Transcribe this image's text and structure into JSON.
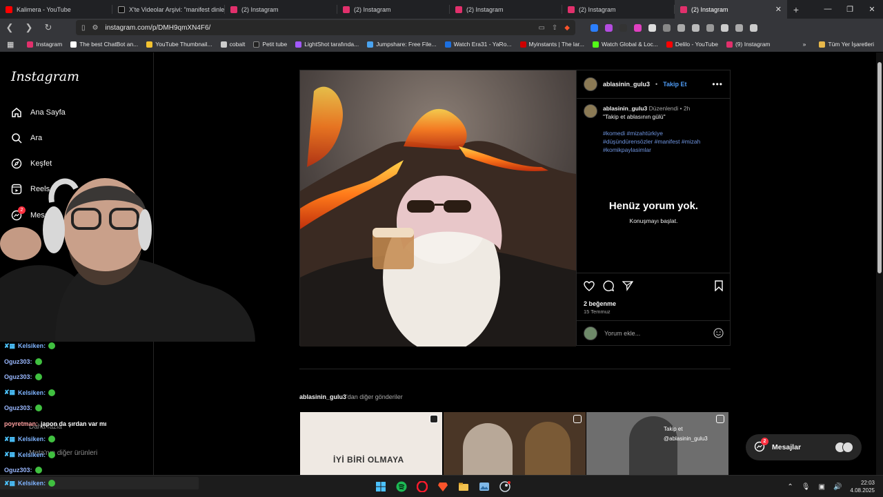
{
  "tabs": [
    {
      "label": "Kalimera - YouTube",
      "color": "#ff0000",
      "active": false
    },
    {
      "label": "X'te Videolar Arşivi: \"manifest dinley",
      "color": "#ffffff",
      "active": false
    },
    {
      "label": "(2) Instagram",
      "color": "#e1306c",
      "active": false
    },
    {
      "label": "(2) Instagram",
      "color": "#e1306c",
      "active": false
    },
    {
      "label": "(2) Instagram",
      "color": "#e1306c",
      "active": false
    },
    {
      "label": "(2) Instagram",
      "color": "#e1306c",
      "active": false
    },
    {
      "label": "(2) Instagram",
      "color": "#e1306c",
      "active": true
    }
  ],
  "address": {
    "url": "instagram.com/p/DMH9qmXN4F6/"
  },
  "bookmarks": [
    {
      "label": "Instagram",
      "color": "#e1306c"
    },
    {
      "label": "The best ChatBot an...",
      "color": "#ffffff"
    },
    {
      "label": "YouTube Thumbnail...",
      "color": "#f2c230"
    },
    {
      "label": "cobalt",
      "color": "#cccccc"
    },
    {
      "label": "Petit tube",
      "color": "#222222"
    },
    {
      "label": "LightShot tarafında...",
      "color": "#a259ff"
    },
    {
      "label": "Jumpshare: Free File...",
      "color": "#4aa3f0"
    },
    {
      "label": "Watch Era31 - YaRo...",
      "color": "#1c6fe0"
    },
    {
      "label": "Myinstants | The lar...",
      "color": "#cc0000"
    },
    {
      "label": "Watch Global & Loc...",
      "color": "#53fc18"
    },
    {
      "label": "Delilo - YouTube",
      "color": "#ff0000"
    },
    {
      "label": "(9) Instagram",
      "color": "#e1306c"
    }
  ],
  "bookmarks_folder": "Tüm Yer İşaretleri",
  "sidebar": {
    "logo": "Instagram",
    "items": [
      {
        "label": "Ana Sayfa",
        "icon": "home-icon"
      },
      {
        "label": "Ara",
        "icon": "search-icon"
      },
      {
        "label": "Keşfet",
        "icon": "compass-icon"
      },
      {
        "label": "Reels",
        "icon": "reels-icon"
      },
      {
        "label": "Mesajlar",
        "icon": "messenger-icon",
        "badge": "2"
      }
    ],
    "more_label": "Daha fazla",
    "meta_label": "Meta'nın diğer ürünleri"
  },
  "post": {
    "username": "ablasinin_gulu3",
    "follow_label": "Takip Et",
    "edited": "Düzenlendi",
    "time": "2h",
    "caption": "\"Takip et ablasının gülü\"",
    "hashtags_line1": "#komedi #mizahtürkiye",
    "hashtags_line2": "#düşündürensözler #manifest #mizah",
    "hashtags_line3": "#komikpaylasimlar",
    "no_comments_title": "Henüz yorum yok.",
    "no_comments_sub": "Konuşmayı başlat.",
    "likes": "2 beğenme",
    "date": "15 Temmuz",
    "comment_placeholder": "Yorum ekle..."
  },
  "more_posts": {
    "username": "ablasinin_gulu3",
    "suffix": "'dan diğer gönderiler",
    "thumb1_text": "İYİ BİRİ OLMAYA",
    "thumb3_line1": "Takip et",
    "thumb3_line2": "@ablasinin_gulu3"
  },
  "messages_pill": {
    "label": "Mesajlar",
    "badge": "2"
  },
  "chat": [
    {
      "name": "Kelsiken:",
      "badged": true,
      "text": ""
    },
    {
      "name": "Oguz303:",
      "badged": false,
      "text": ""
    },
    {
      "name": "Oguz303:",
      "badged": false,
      "text": ""
    },
    {
      "name": "Kelsiken:",
      "badged": true,
      "text": ""
    },
    {
      "name": "Oguz303:",
      "badged": false,
      "text": ""
    },
    {
      "name": "poyretman:",
      "badged": false,
      "text": "japon da şırdan var mı"
    },
    {
      "name": "Kelsiken:",
      "badged": true,
      "text": ""
    },
    {
      "name": "Kelsiken:",
      "badged": true,
      "text": ""
    },
    {
      "name": "Oguz303:",
      "badged": false,
      "text": ""
    }
  ],
  "taskbar": {
    "search_chat_name": "Kelsiken:",
    "time": "22:03",
    "date": "4.08.2025"
  }
}
